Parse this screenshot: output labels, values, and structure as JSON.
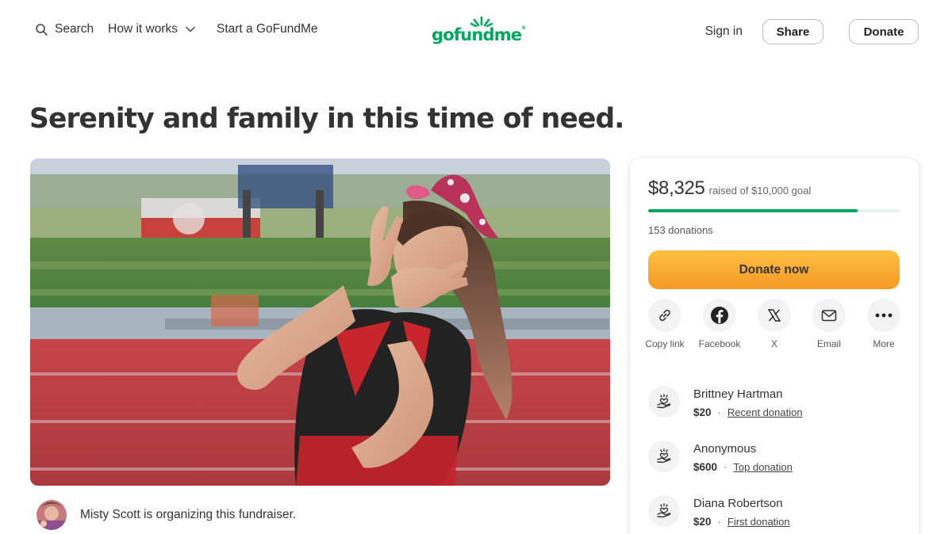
{
  "header": {
    "search_label": "Search",
    "how_label": "How it works",
    "start_label": "Start a GoFundMe",
    "logo_text": "gofundme",
    "signin_label": "Sign in",
    "share_label": "Share",
    "donate_label": "Donate"
  },
  "fundraiser": {
    "title": "Serenity and family in this time of need.",
    "organizer_text": "Misty Scott is organizing this fundraiser."
  },
  "card": {
    "raised_amount": "$8,325",
    "raised_goal_text": "raised of $10,000 goal",
    "progress_fraction": 0.8325,
    "donations_text": "153 donations",
    "donate_now_label": "Donate now",
    "share_items": [
      {
        "label": "Copy link",
        "icon": "link-icon"
      },
      {
        "label": "Facebook",
        "icon": "facebook-icon"
      },
      {
        "label": "X",
        "icon": "x-icon"
      },
      {
        "label": "Email",
        "icon": "mail-icon"
      },
      {
        "label": "More",
        "icon": "more-icon"
      }
    ],
    "donors": [
      {
        "name": "Brittney Hartman",
        "amount": "$20",
        "tag": "Recent donation"
      },
      {
        "name": "Anonymous",
        "amount": "$600",
        "tag": "Top donation"
      },
      {
        "name": "Diana Robertson",
        "amount": "$20",
        "tag": "First donation"
      }
    ]
  },
  "colors": {
    "brand_green": "#02a95c",
    "donate_button": "#f8a929",
    "progress_track": "#e3f4ec"
  }
}
